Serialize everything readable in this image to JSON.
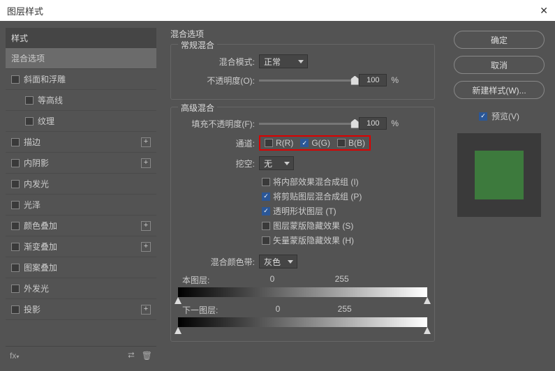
{
  "window": {
    "title": "图层样式"
  },
  "sidebar": {
    "header": "样式",
    "items": [
      {
        "label": "混合选项",
        "selected": true,
        "checkbox": false,
        "plus": false,
        "sub": false
      },
      {
        "label": "斜面和浮雕",
        "checkbox": true,
        "plus": false,
        "sub": false
      },
      {
        "label": "等高线",
        "checkbox": true,
        "plus": false,
        "sub": true
      },
      {
        "label": "纹理",
        "checkbox": true,
        "plus": false,
        "sub": true
      },
      {
        "label": "描边",
        "checkbox": true,
        "plus": true,
        "sub": false
      },
      {
        "label": "内阴影",
        "checkbox": true,
        "plus": true,
        "sub": false
      },
      {
        "label": "内发光",
        "checkbox": true,
        "plus": false,
        "sub": false
      },
      {
        "label": "光泽",
        "checkbox": true,
        "plus": false,
        "sub": false
      },
      {
        "label": "颜色叠加",
        "checkbox": true,
        "plus": true,
        "sub": false
      },
      {
        "label": "渐变叠加",
        "checkbox": true,
        "plus": true,
        "sub": false
      },
      {
        "label": "图案叠加",
        "checkbox": true,
        "plus": false,
        "sub": false
      },
      {
        "label": "外发光",
        "checkbox": true,
        "plus": false,
        "sub": false
      },
      {
        "label": "投影",
        "checkbox": true,
        "plus": true,
        "sub": false
      }
    ],
    "footer_fx": "fx"
  },
  "content": {
    "title": "混合选项",
    "general": {
      "title": "常规混合",
      "mode_label": "混合模式:",
      "mode_value": "正常",
      "opacity_label": "不透明度(O):",
      "opacity_value": "100",
      "pct": "%"
    },
    "advanced": {
      "title": "高级混合",
      "fill_label": "填充不透明度(F):",
      "fill_value": "100",
      "pct": "%",
      "channel_label": "通道:",
      "ch_r": "R(R)",
      "ch_g": "G(G)",
      "ch_b": "B(B)",
      "knockout_label": "挖空:",
      "knockout_value": "无",
      "opts": [
        {
          "label": "将内部效果混合成组 (I)",
          "checked": false
        },
        {
          "label": "将剪贴图层混合成组 (P)",
          "checked": true
        },
        {
          "label": "透明形状图层 (T)",
          "checked": true
        },
        {
          "label": "图层蒙版隐藏效果 (S)",
          "checked": false
        },
        {
          "label": "矢量蒙版隐藏效果 (H)",
          "checked": false
        }
      ],
      "blendif_label": "混合颜色带:",
      "blendif_value": "灰色",
      "this_layer": "本图层:",
      "next_layer": "下一图层:",
      "v0": "0",
      "v255": "255"
    }
  },
  "right": {
    "ok": "确定",
    "cancel": "取消",
    "newstyle": "新建样式(W)...",
    "preview": "预览(V)"
  }
}
